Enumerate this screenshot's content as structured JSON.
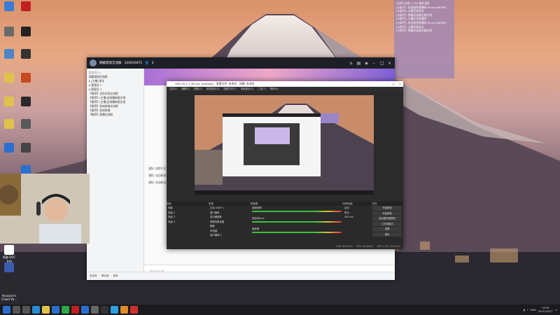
{
  "desktop": {
    "icons": [
      {
        "label": "",
        "color": "#3a7bd5"
      },
      {
        "label": "",
        "color": "#c02020"
      },
      {
        "label": "",
        "color": "#6a6a6a"
      },
      {
        "label": "",
        "color": "#222222"
      },
      {
        "label": "",
        "color": "#4a86c8"
      },
      {
        "label": "",
        "color": "#333333"
      },
      {
        "label": "",
        "color": "#e0c24b"
      },
      {
        "label": "",
        "color": "#c84a1e"
      },
      {
        "label": "",
        "color": "#e0c24b"
      },
      {
        "label": "",
        "color": "#2a2a2a"
      },
      {
        "label": "",
        "color": "#e0c24b"
      },
      {
        "label": "",
        "color": "#5a5a5a"
      },
      {
        "label": "",
        "color": "#2a6fd0"
      },
      {
        "label": "",
        "color": "#444444"
      },
      {
        "label": "",
        "color": "#2a6fd0"
      }
    ],
    "bottom_icons": [
      {
        "label": "简道 DOC 文档",
        "color": "#ffffff"
      },
      {
        "label": "",
        "color": "#3a5bb0"
      },
      {
        "label": "Assassin's Creed Va...",
        "color": "#2a2a2a"
      }
    ]
  },
  "chat_overlay": {
    "lines": [
      "[分享] 在线 1,123 聊天消息",
      "[小助手]: 欢迎来到直播间 Emery.Mt0987",
      "[小助手]: 公屏开放发言",
      "[小助手]: 弹幕开启请注意文明",
      "[小助手]: 主播正在直播中",
      "",
      "[小助手]: 欢迎来到直播间 Emery.Mt0987",
      "[小助手]: 公屏开放发言",
      "[小助手]: 弹幕开启请注意文明"
    ]
  },
  "qq": {
    "title": "网瘾游戏交流群",
    "group_id": "145616471",
    "member_count": "2",
    "side_header": "群成员(1)",
    "side_items": [
      "网瘾游戏交流群",
      "▸ [主播] 群主",
      "▸ 管理员 2",
      "▸ 管理员 3",
      "【推荐】全民对局交流群",
      "【推荐】[主播]全网最新版交流",
      "【推荐】[主播]全网最新版交流",
      "【推荐】游戏攻略交流群",
      "【推荐】游戏攻略",
      "【推荐】直播交流群"
    ],
    "messages": [
      "通知: 加群方式",
      "通知: 欢迎新成员",
      "通知: 欢迎新成员"
    ],
    "input_placeholder": "说点什么吧...",
    "bottom": [
      "发动态",
      "群应用",
      "更多"
    ]
  },
  "obs": {
    "title": "OBS 26.1.1 (64-bit, windows) - 配置文件: 未命名 - 场景: 未命名",
    "menu": [
      "文件(F)",
      "编辑(E)",
      "视图(V)",
      "停靠部件(D)",
      "配置文件(P)",
      "场景集合(S)",
      "工具(T)",
      "帮助(H)"
    ],
    "dock_headers": [
      "场景",
      "来源",
      "混音器",
      "转场动画",
      "控件"
    ],
    "scenes": [
      "场景",
      "场景 2",
      "场景 3",
      "场景 4"
    ],
    "sources": [
      "文本 (GDI+)",
      "窗口捕获",
      "显示器捕获",
      "视频采集设备",
      "图像",
      "浏览器",
      "窗口捕获 2"
    ],
    "mixer": [
      "桌面音频",
      "麦克风/Aux",
      "媒体源"
    ],
    "transition": [
      "淡出",
      "时长",
      "300 ms"
    ],
    "controls": [
      "开始推流",
      "开始录制",
      "启动虚拟摄像机",
      "工作室模式",
      "设置",
      "退出"
    ],
    "status": [
      "LIVE: 00:00:00",
      "REC: 00:00:00",
      "CPU: 1.2%, 30.00 fps"
    ]
  },
  "taskbar": {
    "icons": [
      {
        "name": "windows-start-icon",
        "color": "#2a6fd0"
      },
      {
        "name": "search-icon",
        "color": "#555"
      },
      {
        "name": "task-view-icon",
        "color": "#555"
      },
      {
        "name": "edge-icon",
        "color": "#2a8ad0"
      },
      {
        "name": "explorer-icon",
        "color": "#e0c24b"
      },
      {
        "name": "store-icon",
        "color": "#2a6fd0"
      },
      {
        "name": "green-app-icon",
        "color": "#2ca84a"
      },
      {
        "name": "red-app-icon",
        "color": "#c02020"
      },
      {
        "name": "blue-app-icon",
        "color": "#2a6fd0"
      },
      {
        "name": "gray-app-icon",
        "color": "#666"
      },
      {
        "name": "obs-icon",
        "color": "#333"
      },
      {
        "name": "qq-icon",
        "color": "#2aa0e0"
      },
      {
        "name": "orange-app-icon",
        "color": "#e08a2a"
      },
      {
        "name": "red2-app-icon",
        "color": "#d03030"
      }
    ],
    "tray_lang": "ENG",
    "time": "14:00",
    "date": "2021/10/27"
  }
}
